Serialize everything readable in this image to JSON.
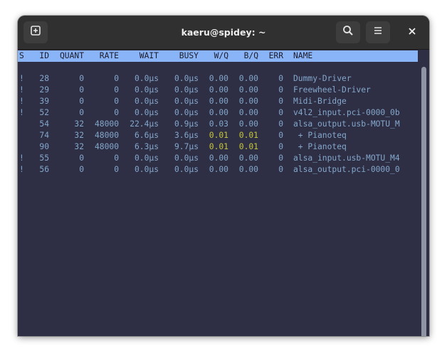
{
  "window": {
    "title": "kaeru@spidey: ~"
  },
  "icons": {
    "new_tab": "new-tab-icon",
    "search": "search-icon",
    "menu": "hamburger-menu-icon",
    "close": "close-icon"
  },
  "table": {
    "headers": {
      "s": "S",
      "id": "ID",
      "quant": "QUANT",
      "rate": "RATE",
      "wait": "WAIT",
      "busy": "BUSY",
      "wq": "W/Q",
      "bq": "B/Q",
      "err": "ERR",
      "name": "NAME"
    },
    "rows": [
      {
        "s": "!",
        "id": "28",
        "quant": "0",
        "rate": "0",
        "wait": "0.0µs",
        "busy": "0.0µs",
        "wq": "0.00",
        "bq": "0.00",
        "err": "0",
        "name": "Dummy-Driver"
      },
      {
        "s": "!",
        "id": "29",
        "quant": "0",
        "rate": "0",
        "wait": "0.0µs",
        "busy": "0.0µs",
        "wq": "0.00",
        "bq": "0.00",
        "err": "0",
        "name": "Freewheel-Driver"
      },
      {
        "s": "!",
        "id": "39",
        "quant": "0",
        "rate": "0",
        "wait": "0.0µs",
        "busy": "0.0µs",
        "wq": "0.00",
        "bq": "0.00",
        "err": "0",
        "name": "Midi-Bridge"
      },
      {
        "s": "!",
        "id": "52",
        "quant": "0",
        "rate": "0",
        "wait": "0.0µs",
        "busy": "0.0µs",
        "wq": "0.00",
        "bq": "0.00",
        "err": "0",
        "name": "v4l2_input.pci-0000_0b"
      },
      {
        "s": "",
        "id": "54",
        "quant": "32",
        "rate": "48000",
        "wait": "22.4µs",
        "busy": "0.9µs",
        "wq": "0.03",
        "bq": "0.00",
        "err": "0",
        "name": "alsa_output.usb-MOTU_M"
      },
      {
        "s": "",
        "id": "74",
        "quant": "32",
        "rate": "48000",
        "wait": "6.6µs",
        "busy": "3.6µs",
        "wq": "0.01",
        "bq": "0.01",
        "err": "0",
        "name": " + Pianoteq"
      },
      {
        "s": "",
        "id": "90",
        "quant": "32",
        "rate": "48000",
        "wait": "6.3µs",
        "busy": "9.7µs",
        "wq": "0.01",
        "bq": "0.01",
        "err": "0",
        "name": " + Pianoteq"
      },
      {
        "s": "!",
        "id": "55",
        "quant": "0",
        "rate": "0",
        "wait": "0.0µs",
        "busy": "0.0µs",
        "wq": "0.00",
        "bq": "0.00",
        "err": "0",
        "name": "alsa_input.usb-MOTU_M4"
      },
      {
        "s": "!",
        "id": "56",
        "quant": "0",
        "rate": "0",
        "wait": "0.0µs",
        "busy": "0.0µs",
        "wq": "0.00",
        "bq": "0.00",
        "err": "0",
        "name": "alsa_output.pci-0000_0"
      }
    ]
  },
  "colors": {
    "terminal_bg": "#2e2e44",
    "terminal_fg": "#84a8cc",
    "header_bg": "#8ab4f8",
    "highlight_yellow": "#c7c63a",
    "titlebar_bg": "#303030"
  }
}
